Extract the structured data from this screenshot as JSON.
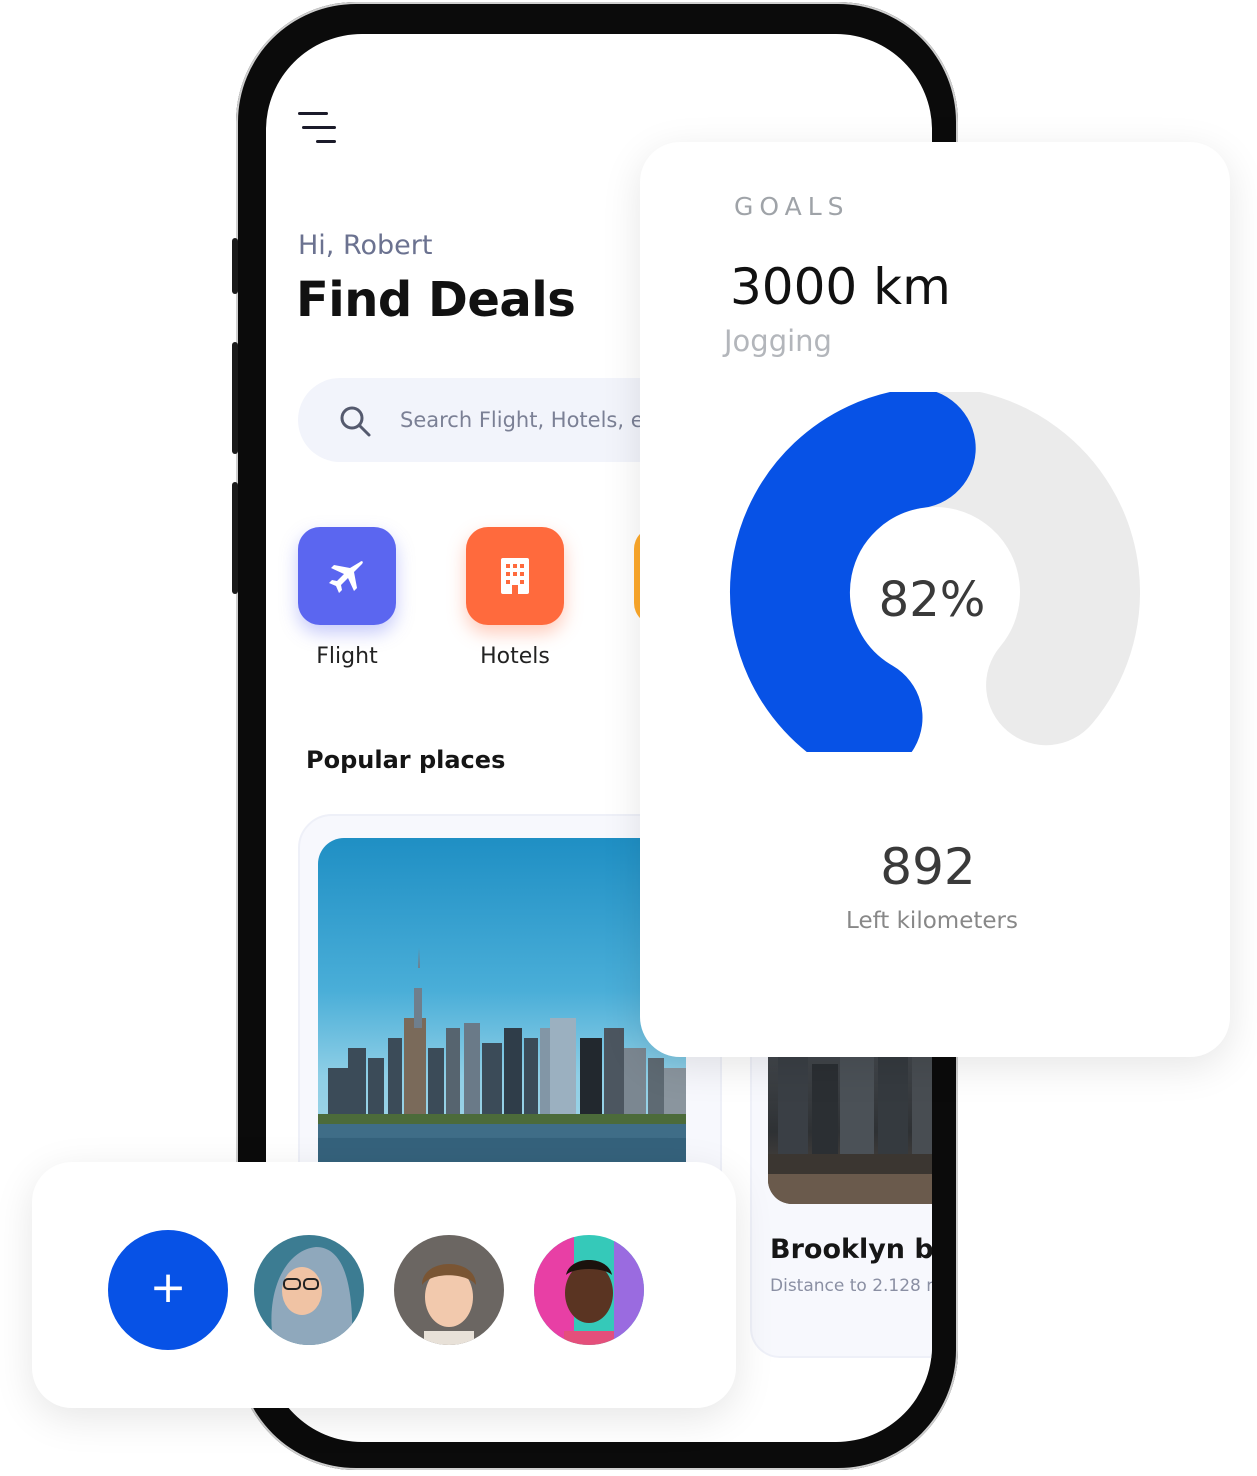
{
  "app": {
    "greeting": "Hi, Robert",
    "title": "Find Deals",
    "search": {
      "placeholder": "Search Flight, Hotels, e"
    },
    "categories": [
      {
        "label": "Flight",
        "icon": "airplane-icon",
        "color": "#5b66f0"
      },
      {
        "label": "Hotels",
        "icon": "building-icon",
        "color": "#ff6a3d"
      },
      {
        "label": "",
        "icon": "category-icon",
        "color": "#ffaa2b"
      }
    ],
    "popular_title": "Popular places",
    "places": [
      {
        "title": "",
        "subtitle": ""
      },
      {
        "title": "Brooklyn br",
        "subtitle": "Distance to 2.128 r"
      }
    ]
  },
  "goals": {
    "label": "GOALS",
    "distance": "3000 km",
    "activity": "Jogging",
    "percent_label": "82%",
    "progress": 0.82,
    "remaining": "892",
    "remaining_label": "Left kilometers",
    "colors": {
      "progress": "#0752e6",
      "track": "#ebebeb"
    }
  },
  "friends": {
    "add_label": "+",
    "avatars": [
      "avatar-woman-hood",
      "avatar-man-curly",
      "avatar-man-colorful"
    ]
  }
}
